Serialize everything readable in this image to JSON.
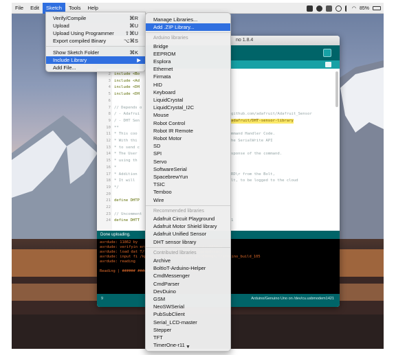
{
  "menubar": {
    "items": [
      "File",
      "Edit",
      "Sketch",
      "Tools",
      "Help"
    ],
    "battery": "85%"
  },
  "window": {
    "title_fragment": "no 1.8.4"
  },
  "sketch_menu": {
    "items": [
      {
        "label": "Verify/Compile",
        "shortcut": "⌘R"
      },
      {
        "label": "Upload",
        "shortcut": "⌘U"
      },
      {
        "label": "Upload Using Programmer",
        "shortcut": "⇧⌘U"
      },
      {
        "label": "Export compiled Binary",
        "shortcut": "⌥⌘S"
      },
      {
        "label": "Show Sketch Folder",
        "shortcut": "⌘K"
      },
      {
        "label": "Include Library",
        "shortcut": ""
      },
      {
        "label": "Add File...",
        "shortcut": ""
      }
    ]
  },
  "library_menu": {
    "manage": "Manage Libraries...",
    "add_zip": "Add .ZIP Library...",
    "arduino_header": "Arduino libraries",
    "arduino_libs": [
      "Bridge",
      "EEPROM",
      "Esplora",
      "Ethernet",
      "Firmata",
      "HID",
      "Keyboard",
      "LiquidCrystal",
      "LiquidCrystal_I2C",
      "Mouse",
      "Robot Control",
      "Robot IR Remote",
      "Robot Motor",
      "SD",
      "SPI",
      "Servo",
      "SoftwareSerial",
      "SpacebrewYun",
      "TSIC",
      "Temboo",
      "Wire"
    ],
    "recommended_header": "Recommended libraries",
    "recommended_libs": [
      "Adafruit Circuit Playground",
      "Adafruit Motor Shield library",
      "Adafruit Unified Sensor",
      "DHT sensor library"
    ],
    "contributed_header": "Contributed libraries",
    "contributed_libs": [
      "Archive",
      "BoltIoT-Arduino-Helper",
      "CmdMessenger",
      "CmdParser",
      "DevDuino",
      "GSM",
      "NeoSWSerial",
      "PubSubClient",
      "Serial_LCD-master",
      "Stepper",
      "TFT",
      "TimerOne-r11"
    ]
  },
  "editor": {
    "lines": [
      {
        "n": "2",
        "code": "include <Bo"
      },
      {
        "n": "3",
        "code": "include <Ad"
      },
      {
        "n": "4",
        "code": "include <DH"
      },
      {
        "n": "5",
        "code": "include <DH"
      },
      {
        "n": "6",
        "code": ""
      },
      {
        "n": "7",
        "code": "// Depends o"
      },
      {
        "n": "8",
        "code": "/ - Adafrui",
        "right": "github.com/adafruit/Adafruit_Sensor"
      },
      {
        "n": "9",
        "code": "/ - DHT Sen",
        "right": "adafruit/DHT-sensor-library"
      },
      {
        "n": "10",
        "code": "**"
      },
      {
        "n": "11",
        "code": " * This coo",
        "right": "mmand Handler Code."
      },
      {
        "n": "12",
        "code": " * With thi",
        "right": "he SerialWrite API"
      },
      {
        "n": "13",
        "code": " * to send c"
      },
      {
        "n": "14",
        "code": " * The User",
        "right": "sponse of the command."
      },
      {
        "n": "15",
        "code": " * using th"
      },
      {
        "n": "16",
        "code": " *"
      },
      {
        "n": "17",
        "code": " * Addition",
        "right": "RD\\r from the Bolt,"
      },
      {
        "n": "18",
        "code": " * It will",
        "right": "lt, to be logged to the cloud"
      },
      {
        "n": "19",
        "code": " */"
      },
      {
        "n": "20",
        "code": ""
      },
      {
        "n": "21",
        "code": "define DHTP"
      },
      {
        "n": "22",
        "code": ""
      },
      {
        "n": "23",
        "code": "// Uncomment"
      },
      {
        "n": "24",
        "code": "define DHTT",
        "right": "1"
      }
    ]
  },
  "status": {
    "text": "Done uploading."
  },
  "console": {
    "lines": [
      "avrdude: 11862 by",
      "avrdude: verifyin                               ers/kp/9gnp402j7_nfb1qpdpdkxgcr0000gn",
      "avrdude: load dat                               T/folders/kp/9gnp402j7_nfb1qpdpdkxgcr",
      "avrdude: input fi                               /kp/9gnp402j7_nfb1qpdpdkxgcr0000gn/T/arduino_build_105",
      "avrdude: reading",
      "",
      "Reading | ######                       ############## | 100% 1.54s"
    ]
  },
  "bottombar": {
    "line_number": "9",
    "board": "Arduino/Genuino Uno on /dev/cu.usbmodem1421"
  },
  "colors": {
    "selection": "#2f6fe0",
    "arduino_teal": "#006468",
    "console_text": "#e06a2a"
  }
}
